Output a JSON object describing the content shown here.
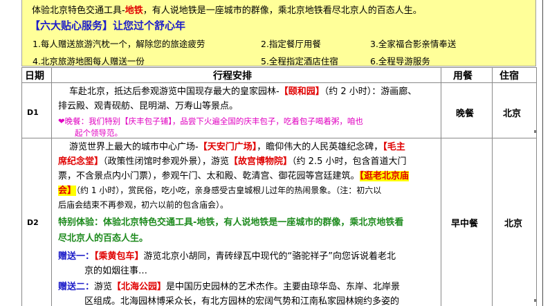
{
  "intro": {
    "before": "体验北京特色交通工具-",
    "highlight": "地铁",
    "after": "，有人说地铁是一座城市的群像，乘北京地铁看尽北京人的百态人生。"
  },
  "services": {
    "title": "【六大贴心服务】让您过个舒心年",
    "items": [
      "1.每人赠送旅游汽枕一个，解除您的旅途疲劳",
      "2.指定餐厅用餐",
      "3.全家福合影亲情奉送",
      "4.北京旅游地图每人赠送一份",
      "5.全程指定酒店住宿",
      "6.全程导游服务"
    ]
  },
  "table": {
    "headers": {
      "date": "日期",
      "itinerary": "行程安排",
      "meal": "用餐",
      "hotel": "住宿"
    },
    "rows": [
      {
        "day": "D1",
        "meal": "晚餐",
        "hotel": "北京",
        "line1_a": "车赴北京，抵达后参观游览中国现存最大的皇家园林-",
        "line1_b": "【颐和园】",
        "line1_c": "（约 2 小时）：游画廊、",
        "line2": "排云殿、观青砚舫、昆明湖、万寿山等景点。",
        "tip1": "❤晚餐：我们特别【庆丰包子铺】，品尝下火遍全国的庆丰包子，吃着包子喝着粥，咱也",
        "tip2": "起个领导范。"
      },
      {
        "day": "D2",
        "meal": "早中餐",
        "hotel": "北京",
        "p1": "游览世界上最大的城市中心广场-",
        "p2": "【天安门广场】",
        "p3": "，瞻仰伟大的人民英雄纪念碑，",
        "p4": "【毛主",
        "p5": "席纪念堂】",
        "p6": "（政策性闭馆时参观外景），游览",
        "p7": "【故宫博物院】",
        "p8": "（约 2.5 小时，包含首道大门",
        "p9": "票，不含景点内小门票），参观午门、太和殿、乾清宫、御花园等宫廷建筑。",
        "p10": "【逛老北京庙",
        "p11": "会】",
        "p12": "（约 1 小时），赏民俗，吃小吃，亲身感受古皇城根儿过年的热闹景象。（注：初六以",
        "p13": "后庙会结束不再参观，初六以前的包含庙会）。",
        "sp1": "特别体验：体验北京特色交通工具-地铁，有人说地铁是一座城市的群像，乘北京地铁看",
        "sp2": "尽北京人的百态人生。",
        "g1_label": "赠送一：",
        "g1_h": "【乘黄包车】",
        "g1_t": "游览北京小胡同，青砖绿瓦中现代的“骆驼祥子”向您诉说着老北",
        "g1_t2": "京的如烟往事…",
        "g2_label": "赠送二：",
        "g2_a": "游览",
        "g2_h": "【北海公园】",
        "g2_t": "是中国历史园林的艺术杰作。主要由琼华岛、东岸、北岸景",
        "g2_t2": "区组成。北海园林博采众长，有北方园林的宏阔气势和江南私家园林婉约多姿的"
      }
    ]
  }
}
